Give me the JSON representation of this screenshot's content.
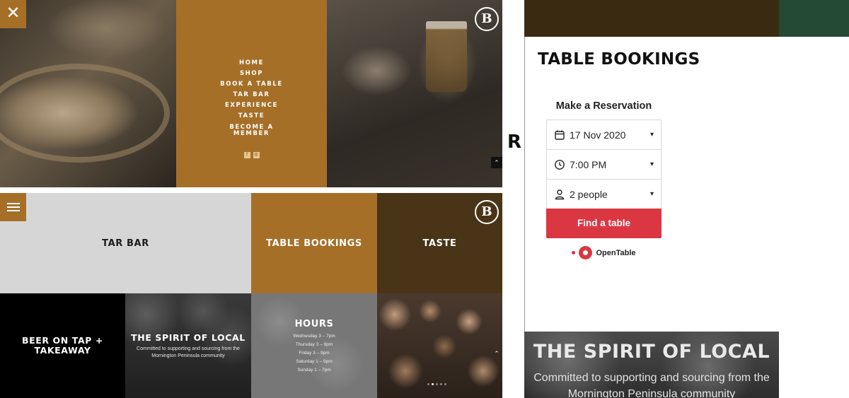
{
  "menu_panel": {
    "close_icon": "close-icon",
    "logo_letter": "B",
    "menu_items": [
      "HOME",
      "SHOP",
      "BOOK A TABLE",
      "TAR BAR",
      "EXPERIENCE",
      "TASTE",
      "BECOME A",
      "MEMBER"
    ],
    "social": [
      {
        "icon": "facebook-icon",
        "glyph": "f"
      },
      {
        "icon": "instagram-icon",
        "glyph": "◎"
      }
    ],
    "scroll_up_glyph": "⌃"
  },
  "home_grid": {
    "menu_icon": "hamburger-icon",
    "logo_letter": "B",
    "tiles": {
      "tar_bar": "TAR BAR",
      "table_bookings": "TABLE BOOKINGS",
      "taste": "TASTE",
      "beer_line1": "BEER ON TAP +",
      "beer_line2": "TAKEAWAY",
      "spirit_title": "THE SPIRIT OF LOCAL",
      "spirit_sub1": "Committed to supporting and sourcing from the",
      "spirit_sub2": "Mornington Peninsula community",
      "hours_title": "HOURS",
      "hours": [
        "Wednesday 3 – 7pm",
        "Thursday 3 – 9pm",
        "Friday 3 – 9pm",
        "Saturday 1 – 9pm",
        "Sunday 1 – 7pm"
      ]
    },
    "scroll_up_glyph": "⌃"
  },
  "booking": {
    "background_letter": "R",
    "modal_title": "TABLE BOOKINGS",
    "widget_heading": "Make a Reservation",
    "date_value": "17 Nov 2020",
    "time_value": "7:00 PM",
    "party_value": "2 people",
    "find_button": "Find a table",
    "brand": "OpenTable",
    "brand_mark": "·",
    "spirit_title": "THE SPIRIT OF LOCAL",
    "spirit_sub1": "Committed to supporting and sourcing from the",
    "spirit_sub2": "Mornington Peninsula community",
    "accent_color": "#da3743"
  },
  "colors": {
    "brand_gold": "#a66f28",
    "brand_brown": "#4a3417",
    "light_grey": "#d6d6d6"
  }
}
